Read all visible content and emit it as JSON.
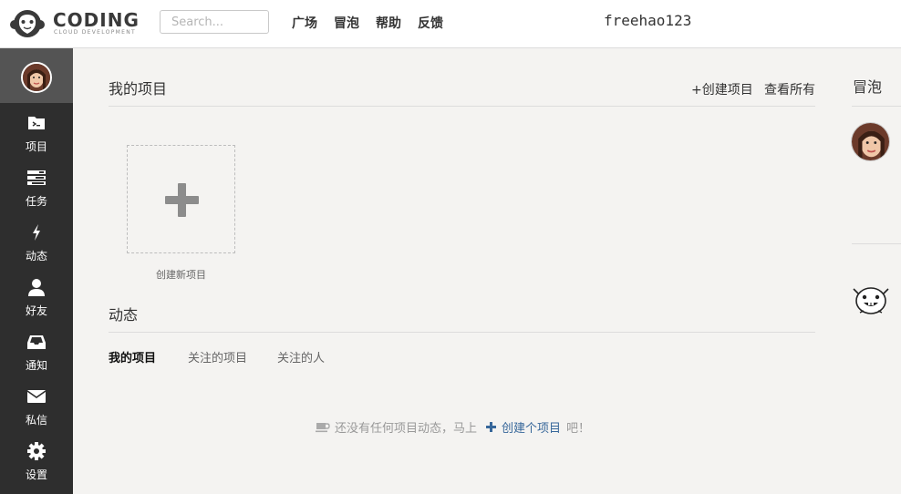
{
  "header": {
    "logo": {
      "word": "CODING",
      "sub": "CLOUD DEVELOPMENT"
    },
    "search": {
      "placeholder": "Search..."
    },
    "nav": [
      "广场",
      "冒泡",
      "帮助",
      "反馈"
    ],
    "username": "freehao123"
  },
  "sidebar": {
    "items": [
      {
        "label": "项目",
        "icon": "folder-icon"
      },
      {
        "label": "任务",
        "icon": "tasks-icon"
      },
      {
        "label": "动态",
        "icon": "bolt-icon"
      },
      {
        "label": "好友",
        "icon": "user-icon"
      },
      {
        "label": "通知",
        "icon": "inbox-icon"
      },
      {
        "label": "私信",
        "icon": "envelope-icon"
      },
      {
        "label": "设置",
        "icon": "gear-icon"
      }
    ]
  },
  "projects": {
    "title": "我的项目",
    "create_link": "+创建项目",
    "view_all_link": "查看所有",
    "new_project_label": "创建新项目"
  },
  "activity": {
    "title": "动态",
    "tabs": [
      "我的项目",
      "关注的项目",
      "关注的人"
    ],
    "active_tab": "我的项目",
    "empty_text": "还没有任何项目动态，马上",
    "empty_link": "创建个项目",
    "empty_suffix": "吧！"
  },
  "bubble": {
    "title": "冒泡"
  },
  "colors": {
    "sidebar_bg": "#2e2e2e",
    "page_bg": "#f4f3f1",
    "link": "#37679a"
  }
}
